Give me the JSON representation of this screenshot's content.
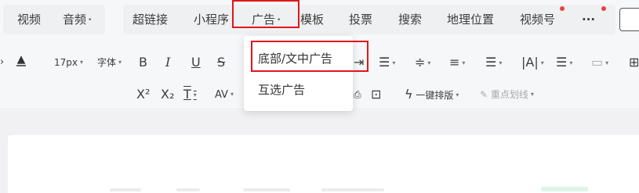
{
  "topnav": {
    "tabs": [
      {
        "label": "视频"
      },
      {
        "label": "音频",
        "caret": "•"
      },
      {
        "label": "超链接"
      },
      {
        "label": "小程序"
      },
      {
        "label": "广告",
        "caret": "•"
      },
      {
        "label": "模板"
      },
      {
        "label": "投票"
      },
      {
        "label": "搜索"
      },
      {
        "label": "地理位置"
      },
      {
        "label": "视频号"
      },
      {
        "label": "···"
      }
    ]
  },
  "ad_dropdown": {
    "items": [
      {
        "label": "底部/文中广告"
      },
      {
        "label": "互选广告"
      }
    ]
  },
  "toolbar": {
    "font_size": "17px",
    "font_family": "字体",
    "bold": "B",
    "italic": "I",
    "underline": "U",
    "strike": "S",
    "superscript": "X²",
    "subscript": "X₂",
    "one_click_layout": "一键排版",
    "highlight": "重点划线",
    "caret": "▾"
  },
  "colors": {
    "highlight_box": "#e0161c",
    "notify_dot": "#e64340",
    "accent": "#07c160"
  }
}
